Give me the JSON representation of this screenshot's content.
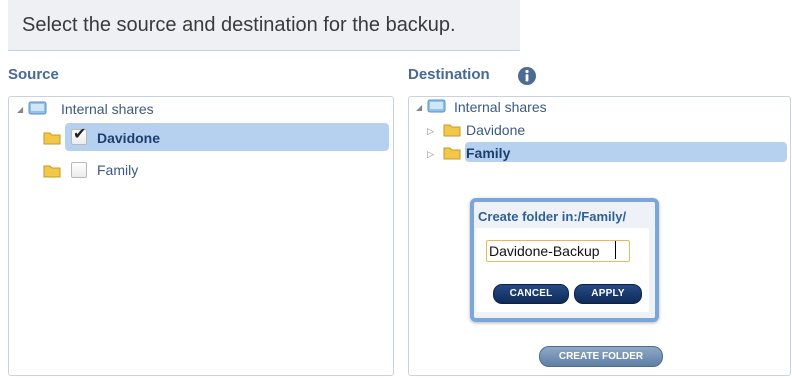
{
  "heading": "Select the source and destination for the backup.",
  "source": {
    "label": "Source",
    "root_label": "Internal shares",
    "items": [
      {
        "label": "Davidone",
        "checked": true,
        "selected": true
      },
      {
        "label": "Family",
        "checked": false,
        "selected": false
      }
    ]
  },
  "destination": {
    "label": "Destination",
    "info_icon": "info-icon",
    "root_label": "Internal shares",
    "items": [
      {
        "label": "Davidone",
        "selected": false
      },
      {
        "label": "Family",
        "selected": true
      }
    ],
    "create_folder_label": "CREATE FOLDER"
  },
  "dialog": {
    "title": "Create folder in:/Family/",
    "input_value": "Davidone-Backup",
    "cancel_label": "CANCEL",
    "apply_label": "APPLY"
  },
  "colors": {
    "accent": "#466a95",
    "selection": "#b6d1ef",
    "button_dark": "#1a3a6e"
  }
}
